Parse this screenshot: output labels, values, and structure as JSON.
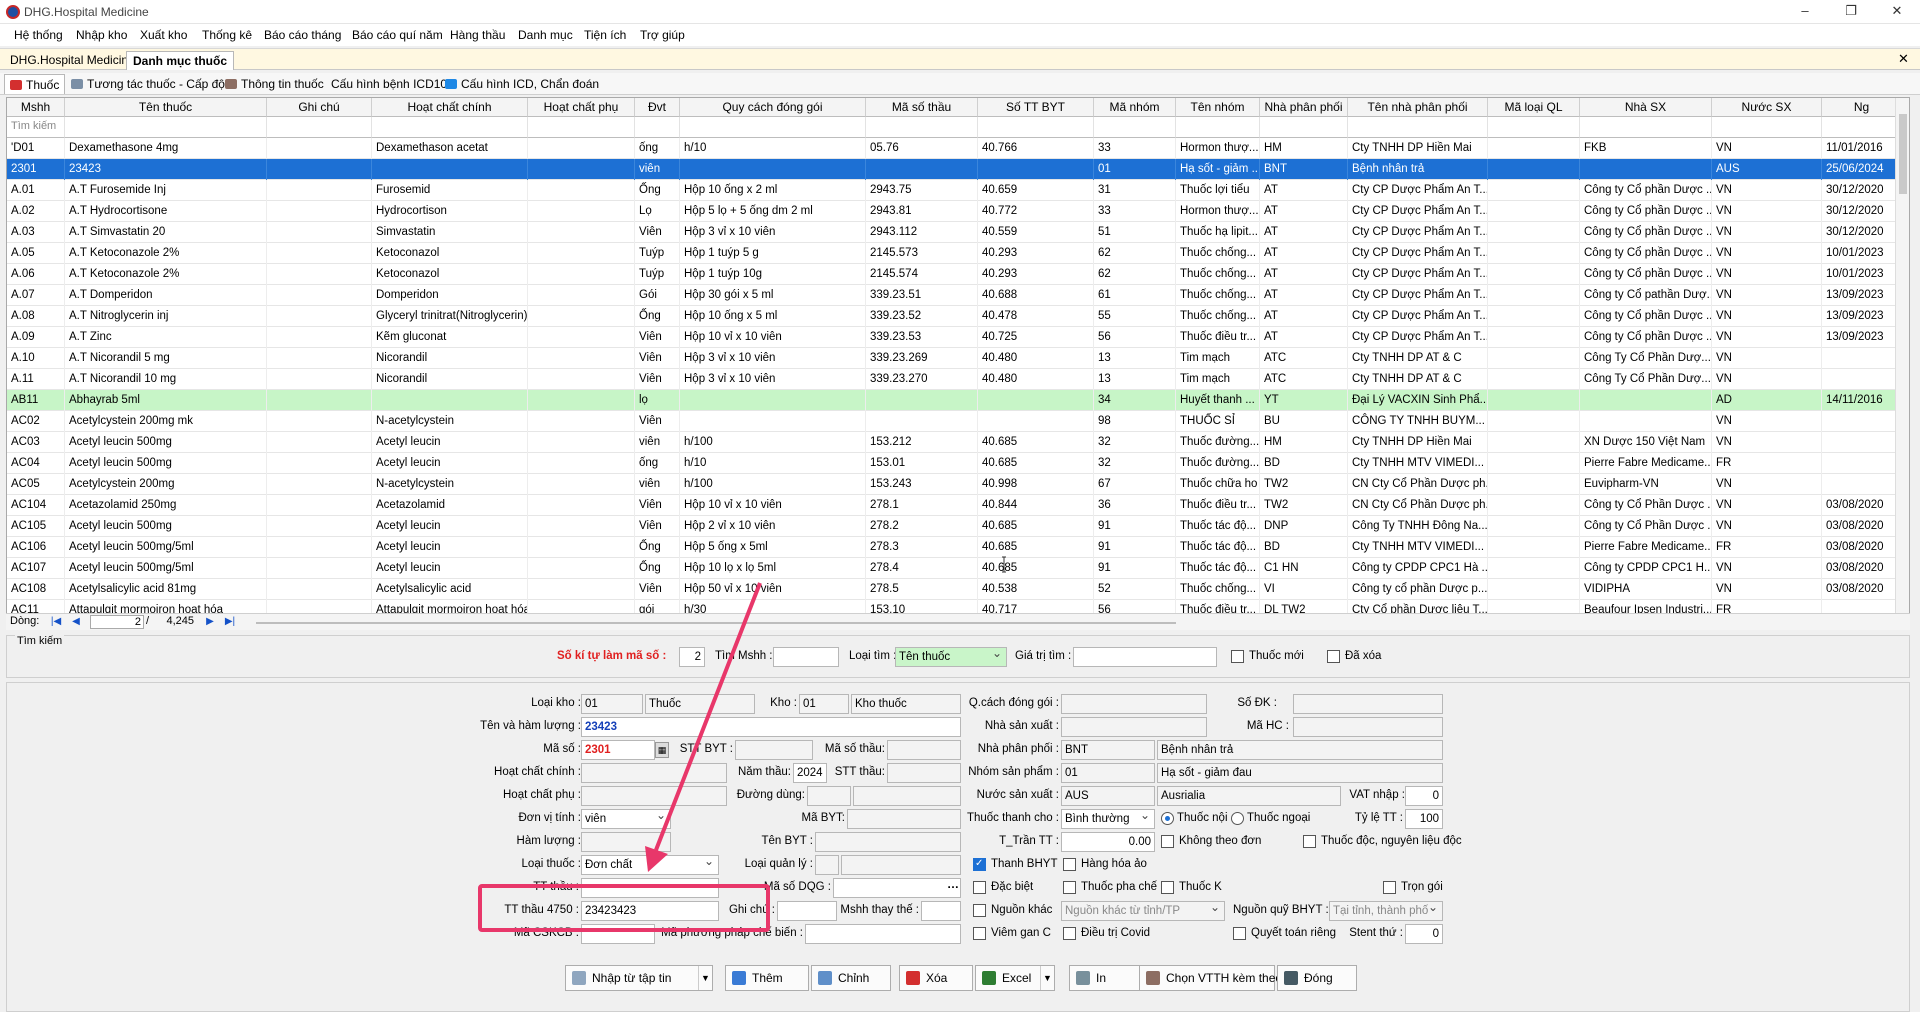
{
  "window": {
    "title": "DHG.Hospital Medicine"
  },
  "menu": [
    "Hệ thống",
    "Nhập kho",
    "Xuất kho",
    "Thống kê",
    "Báo cáo tháng",
    "Báo cáo quí năm",
    "Hàng thầu",
    "Danh mục",
    "Tiện ích",
    "Trợ giúp"
  ],
  "doc_tabs": [
    "DHG.Hospital Medicine",
    "Danh mục thuốc"
  ],
  "sub_tabs": [
    "Thuốc",
    "Tương tác thuốc - Cấp độ",
    "Thông tin thuốc",
    "Cấu hình bệnh ICD10",
    "Cấu hình ICD, Chẩn đoán"
  ],
  "grid": {
    "filter_placeholder": "Tìm kiếm",
    "columns": [
      "Mshh",
      "Tên thuốc",
      "Ghi chú",
      "Hoạt chất chính",
      "Hoạt chất phụ",
      "Đvt",
      "Quy cách đóng gói",
      "Mã số thầu",
      "Số TT BYT",
      "Mã nhóm",
      "Tên nhóm",
      "Nhà phân phối",
      "Tên nhà phân phối",
      "Mã loại QL",
      "Nhà SX",
      "Nước SX",
      "Ng"
    ],
    "rows": [
      [
        "'D01",
        "Dexamethasone 4mg",
        "",
        "Dexamethason acetat",
        "",
        "ống",
        "h/10",
        "05.76",
        "40.766",
        "33",
        "Hormon thượ...",
        "HM",
        "Cty TNHH DP Hiền Mai",
        "",
        "FKB",
        "VN",
        "11/01/2016"
      ],
      [
        "2301",
        "23423",
        "",
        "",
        "",
        "viên",
        "",
        "",
        "",
        "01",
        "Hạ sốt - giảm ...",
        "BNT",
        "Bệnh nhân trả",
        "",
        "",
        "AUS",
        "25/06/2024"
      ],
      [
        "A.01",
        "A.T Furosemide Inj",
        "",
        "Furosemid",
        "",
        "Ống",
        "Hộp 10 ống x 2 ml",
        "2943.75",
        "40.659",
        "31",
        "Thuốc lợi tiểu",
        "AT",
        "Cty CP Dược Phẩm An T...",
        "",
        "Công ty Cổ phần Dược ...",
        "VN",
        "30/12/2020"
      ],
      [
        "A.02",
        "A.T Hydrocortisone",
        "",
        "Hydrocortison",
        "",
        "Lọ",
        "Hộp 5 lọ + 5 ống dm 2 ml",
        "2943.81",
        "40.772",
        "33",
        "Hormon thượ...",
        "AT",
        "Cty CP Dược Phẩm An T...",
        "",
        "Công ty Cổ phần Dược ...",
        "VN",
        "30/12/2020"
      ],
      [
        "A.03",
        "A.T Simvastatin 20",
        "",
        "Simvastatin",
        "",
        "Viên",
        "Hộp 3 vỉ x 10 viên",
        "2943.112",
        "40.559",
        "51",
        "Thuốc hạ lipit...",
        "AT",
        "Cty CP Dược Phẩm An T...",
        "",
        "Công ty Cổ phần Dược ...",
        "VN",
        "30/12/2020"
      ],
      [
        "A.05",
        "A.T Ketoconazole 2%",
        "",
        "Ketoconazol",
        "",
        "Tuýp",
        "Hộp 1 tuýp 5 g",
        "2145.573",
        "40.293",
        "62",
        "Thuốc chống...",
        "AT",
        "Cty CP Dược Phẩm An T...",
        "",
        "Công ty Cổ phần Dược ...",
        "VN",
        "10/01/2023"
      ],
      [
        "A.06",
        "A.T Ketoconazole 2%",
        "",
        "Ketoconazol",
        "",
        "Tuýp",
        "Hộp 1 tuýp 10g",
        "2145.574",
        "40.293",
        "62",
        "Thuốc chống...",
        "AT",
        "Cty CP Dược Phẩm An T...",
        "",
        "Công ty Cổ phần Dược ...",
        "VN",
        "10/01/2023"
      ],
      [
        "A.07",
        "A.T Domperidon",
        "",
        "Domperidon",
        "",
        "Gói",
        "Hộp 30 gói x 5 ml",
        "339.23.51",
        "40.688",
        "61",
        "Thuốc chống...",
        "AT",
        "Cty CP Dược Phẩm An T...",
        "",
        "Công ty Cổ pathần Dượ...",
        "VN",
        "13/09/2023"
      ],
      [
        "A.08",
        "A.T Nitroglycerin inj",
        "",
        "Glyceryl trinitrat(Nitroglycerin)",
        "",
        "Ống",
        "Hộp 10 ống x 5 ml",
        "339.23.52",
        "40.478",
        "55",
        "Thuốc chống...",
        "AT",
        "Cty CP Dược Phẩm An T...",
        "",
        "Công ty Cổ phần Dược ...",
        "VN",
        "13/09/2023"
      ],
      [
        "A.09",
        "A.T Zinc",
        "",
        "Kẽm gluconat",
        "",
        "Viên",
        "Hộp 10 vỉ x 10 viên",
        "339.23.53",
        "40.725",
        "56",
        "Thuốc điều tr...",
        "AT",
        "Cty CP Dược Phẩm An T...",
        "",
        "Công ty Cổ phần Dược ...",
        "VN",
        "13/09/2023"
      ],
      [
        "A.10",
        "A.T Nicorandil 5 mg",
        "",
        "Nicorandil",
        "",
        "Viên",
        "Hộp 3 vỉ x 10 viên",
        "339.23.269",
        "40.480",
        "13",
        "Tim mạch",
        "ATC",
        "Cty TNHH DP AT & C",
        "",
        "Công Ty Cổ Phần Dượ...",
        "VN",
        ""
      ],
      [
        "A.11",
        "A.T Nicorandil 10 mg",
        "",
        "Nicorandil",
        "",
        "Viên",
        "Hộp 3 vỉ x 10 viên",
        "339.23.270",
        "40.480",
        "13",
        "Tim mạch",
        "ATC",
        "Cty TNHH DP AT & C",
        "",
        "Công Ty Cổ Phần Dượ...",
        "VN",
        ""
      ],
      [
        "AB11",
        "Abhayrab 5ml",
        "",
        "",
        "",
        "lọ",
        "",
        "",
        "",
        "34",
        "Huyết thanh ...",
        "YT",
        "Đại Lý VACXIN Sinh Phẩ...",
        "",
        "",
        "AD",
        "14/11/2016"
      ],
      [
        "AC02",
        "Acetylcystein 200mg  mk",
        "",
        "N-acetylcystein",
        "",
        "Viên",
        "",
        "",
        "",
        "98",
        "THUỐC SỈ",
        "BU",
        "CÔNG TY TNHH BUYM...",
        "",
        "",
        "VN",
        ""
      ],
      [
        "AC03",
        "Acetyl leucin 500mg",
        "",
        "Acetyl leucin",
        "",
        "viên",
        "h/100",
        "153.212",
        "40.685",
        "32",
        "Thuốc đường...",
        "HM",
        "Cty TNHH DP Hiền Mai",
        "",
        "XN Dược 150 Việt Nam",
        "VN",
        ""
      ],
      [
        "AC04",
        "Acetyl leucin 500mg",
        "",
        "Acetyl leucin",
        "",
        "ống",
        "h/10",
        "153.01",
        "40.685",
        "32",
        "Thuốc đường...",
        "BD",
        "Cty TNHH MTV VIMEDI...",
        "",
        "Pierre Fabre Medicame...",
        "FR",
        ""
      ],
      [
        "AC05",
        "Acetylcystein 200mg",
        "",
        "N-acetylcystein",
        "",
        "viên",
        "h/100",
        "153.243",
        "40.998",
        "67",
        "Thuốc chữa ho",
        "TW2",
        "CN Cty Cổ Phần Dược ph...",
        "",
        "Euvipharm-VN",
        "VN",
        ""
      ],
      [
        "AC104",
        "Acetazolamid 250mg",
        "",
        "Acetazolamid",
        "",
        "Viên",
        "Hộp 10 vỉ x 10 viên",
        "278.1",
        "40.844",
        "36",
        "Thuốc điều tr...",
        "TW2",
        "CN Cty Cổ Phần Dược ph...",
        "",
        "Công ty Cổ Phần Dược ...",
        "VN",
        "03/08/2020"
      ],
      [
        "AC105",
        "Acetyl leucin 500mg",
        "",
        "Acetyl leucin",
        "",
        "Viên",
        "Hộp 2 vỉ x 10 viên",
        "278.2",
        "40.685",
        "91",
        "Thuốc tác độ...",
        "DNP",
        "Công Ty TNHH Đông Na...",
        "",
        "Công ty Cổ Phần Dược ...",
        "VN",
        "03/08/2020"
      ],
      [
        "AC106",
        "Acetyl leucin 500mg/5ml",
        "",
        "Acetyl leucin",
        "",
        "Ống",
        "Hộp 5 ống x 5ml",
        "278.3",
        "40.685",
        "91",
        "Thuốc tác độ...",
        "BD",
        "Cty TNHH MTV VIMEDI...",
        "",
        "Pierre Fabre Medicame...",
        "FR",
        "03/08/2020"
      ],
      [
        "AC107",
        "Acetyl leucin 500mg/5ml",
        "",
        "Acetyl leucin",
        "",
        "Ống",
        "Hộp 10 lọ x lọ 5ml",
        "278.4",
        "40.685",
        "91",
        "Thuốc tác độ...",
        "C1 HN",
        "Công ty CPDP CPC1 Hà ...",
        "",
        "Công ty CPDP CPC1 H...",
        "VN",
        "03/08/2020"
      ],
      [
        "AC108",
        "Acetylsalicylic acid 81mg",
        "",
        "Acetylsalicylic acid",
        "",
        "Viên",
        "Hộp 50 vỉ x 10 viên",
        "278.5",
        "40.538",
        "52",
        "Thuốc chống...",
        "VI",
        "Công ty cổ phần Dược p...",
        "",
        "VIDIPHA",
        "VN",
        "03/08/2020"
      ],
      [
        "AC11",
        "Attapulgit mormoiron hoạt hóa",
        "",
        "Attapulgit mormoiron hoạt hóa",
        "",
        "gói",
        "h/30",
        "153.10",
        "40.717",
        "56",
        "Thuốc điều tr...",
        "DL TW2",
        "Cty Cổ phần Dược liệu T...",
        "",
        "Beaufour Ipsen Industri...",
        "FR",
        ""
      ]
    ]
  },
  "pager": {
    "label": "Dòng:",
    "current": "2",
    "total": "4,245"
  },
  "search": {
    "panel_label": "Tìm kiếm",
    "so_ki_tu_label": "Số kí tự làm mã số :",
    "so_ki_tu_value": "2",
    "tim_mshh_label": "Tìm Mshh :",
    "loai_tim_label": "Loại tìm :",
    "loai_tim_value": "Tên thuốc",
    "gia_tri_tim_label": "Giá trị tìm :",
    "thuoc_moi_label": "Thuốc mới",
    "da_xoa_label": "Đã xóa"
  },
  "form": {
    "loai_kho_label": "Loại kho :",
    "loai_kho_code": "01",
    "loai_kho_name": "Thuốc",
    "kho_label": "Kho :",
    "kho_code": "01",
    "kho_name": "Kho thuốc",
    "qcach_label": "Q.cách đóng gói :",
    "so_dk_label": "Số ĐK :",
    "ten_ham_luong_label": "Tên và hàm lượng :",
    "ten_ham_luong_value": "23423",
    "nha_sx_label": "Nhà sản xuất :",
    "ma_hc_label": "Mã HC :",
    "ma_so_label": "Mã số :",
    "ma_so_value": "2301",
    "stt_byt_label": "STT BYT :",
    "ma_so_thau_label": "Mã số thầu:",
    "nha_pp_label": "Nhà phân phối :",
    "nha_pp_code": "BNT",
    "nha_pp_name": "Bệnh nhân trả",
    "hoat_chat_chinh_label": "Hoạt chất chính :",
    "nam_thau_label": "Năm thầu:",
    "nam_thau_value": "2024",
    "stt_thau_label": "STT thầu:",
    "nhom_sp_label": "Nhóm sản phẩm :",
    "nhom_sp_code": "01",
    "nhom_sp_name": "Hạ sốt - giảm đau",
    "hoat_chat_phu_label": "Hoạt chất phụ :",
    "duong_dung_label": "Đường dùng:",
    "nuoc_sx_label": "Nước sản xuất :",
    "nuoc_sx_code": "AUS",
    "nuoc_sx_name": "Ausrialia",
    "vat_label": "VAT nhập :",
    "vat_value": "0",
    "don_vi_tinh_label": "Đơn vị tính :",
    "don_vi_tinh_value": "viên",
    "ma_byt_label": "Mã BYT:",
    "thuoc_thanh_cho_label": "Thuốc thanh cho :",
    "thuoc_thanh_cho_value": "Bình thường",
    "thuoc_noi_label": "Thuốc nội",
    "thuoc_ngoai_label": "Thuốc ngoại",
    "ty_le_tt_label": "Tỷ lệ TT :",
    "ty_le_tt_value": "100",
    "ham_luong_label": "Hàm lượng :",
    "ten_byt_label": "Tên BYT :",
    "t_tran_tt_label": "T_Trần TT :",
    "t_tran_tt_value": "0.00",
    "khong_theo_don_label": "Không theo đơn",
    "thuoc_doc_label": "Thuốc độc, nguyên liệu độc",
    "loai_thuoc_label": "Loại thuốc :",
    "loai_thuoc_value": "Đơn chất",
    "loai_quan_ly_label": "Loại quản lý :",
    "thanh_bhyt_label": "Thanh BHYT",
    "hang_hoa_ao_label": "Hàng hóa ảo",
    "tt_thau_label": "TT thầu :",
    "ma_so_dqg_label": "Mã số DQG :",
    "dac_biet_label": "Đặc biệt",
    "thuoc_pha_che_label": "Thuốc pha chế",
    "thuoc_k_label": "Thuốc K",
    "tron_goi_label": "Trọn gói",
    "tt_thau_4750_label": "TT thầu 4750 :",
    "tt_thau_4750_value": "23423423",
    "ghi_chu_label": "Ghi chú :",
    "mshh_thay_the_label": "Mshh thay thế :",
    "nguon_khac_label": "Nguồn khác",
    "nguon_khac_placeholder": "Nguồn khác từ tỉnh/TP",
    "nguon_quy_bhyt_label": "Nguồn quỹ BHYT :",
    "nguon_quy_bhyt_placeholder": "Tại tỉnh, thành phố",
    "ma_cskcb_label": "Mã CSKCB :",
    "ma_pp_che_bien_label": "Mã phương pháp chế biến :",
    "viem_gan_c_label": "Viêm gan C",
    "dieu_tri_covid_label": "Điều trị Covid",
    "quyet_toan_rieng_label": "Quyết toán riêng",
    "stent_thu_label": "Stent thứ :",
    "stent_thu_value": "0"
  },
  "buttons": {
    "nhap_tu_tap_tin": "Nhập từ tập tin",
    "them": "Thêm",
    "chinh": "Chỉnh",
    "xoa": "Xóa",
    "excel": "Excel",
    "in": "In",
    "chon_vtth": "Chọn VTTH kèm theo",
    "dong": "Đóng"
  },
  "colors": {
    "selection": "#1d70d4",
    "highlight_row": "#c7f5c7",
    "annotation": "#e8376a",
    "red_label": "#e02020"
  }
}
